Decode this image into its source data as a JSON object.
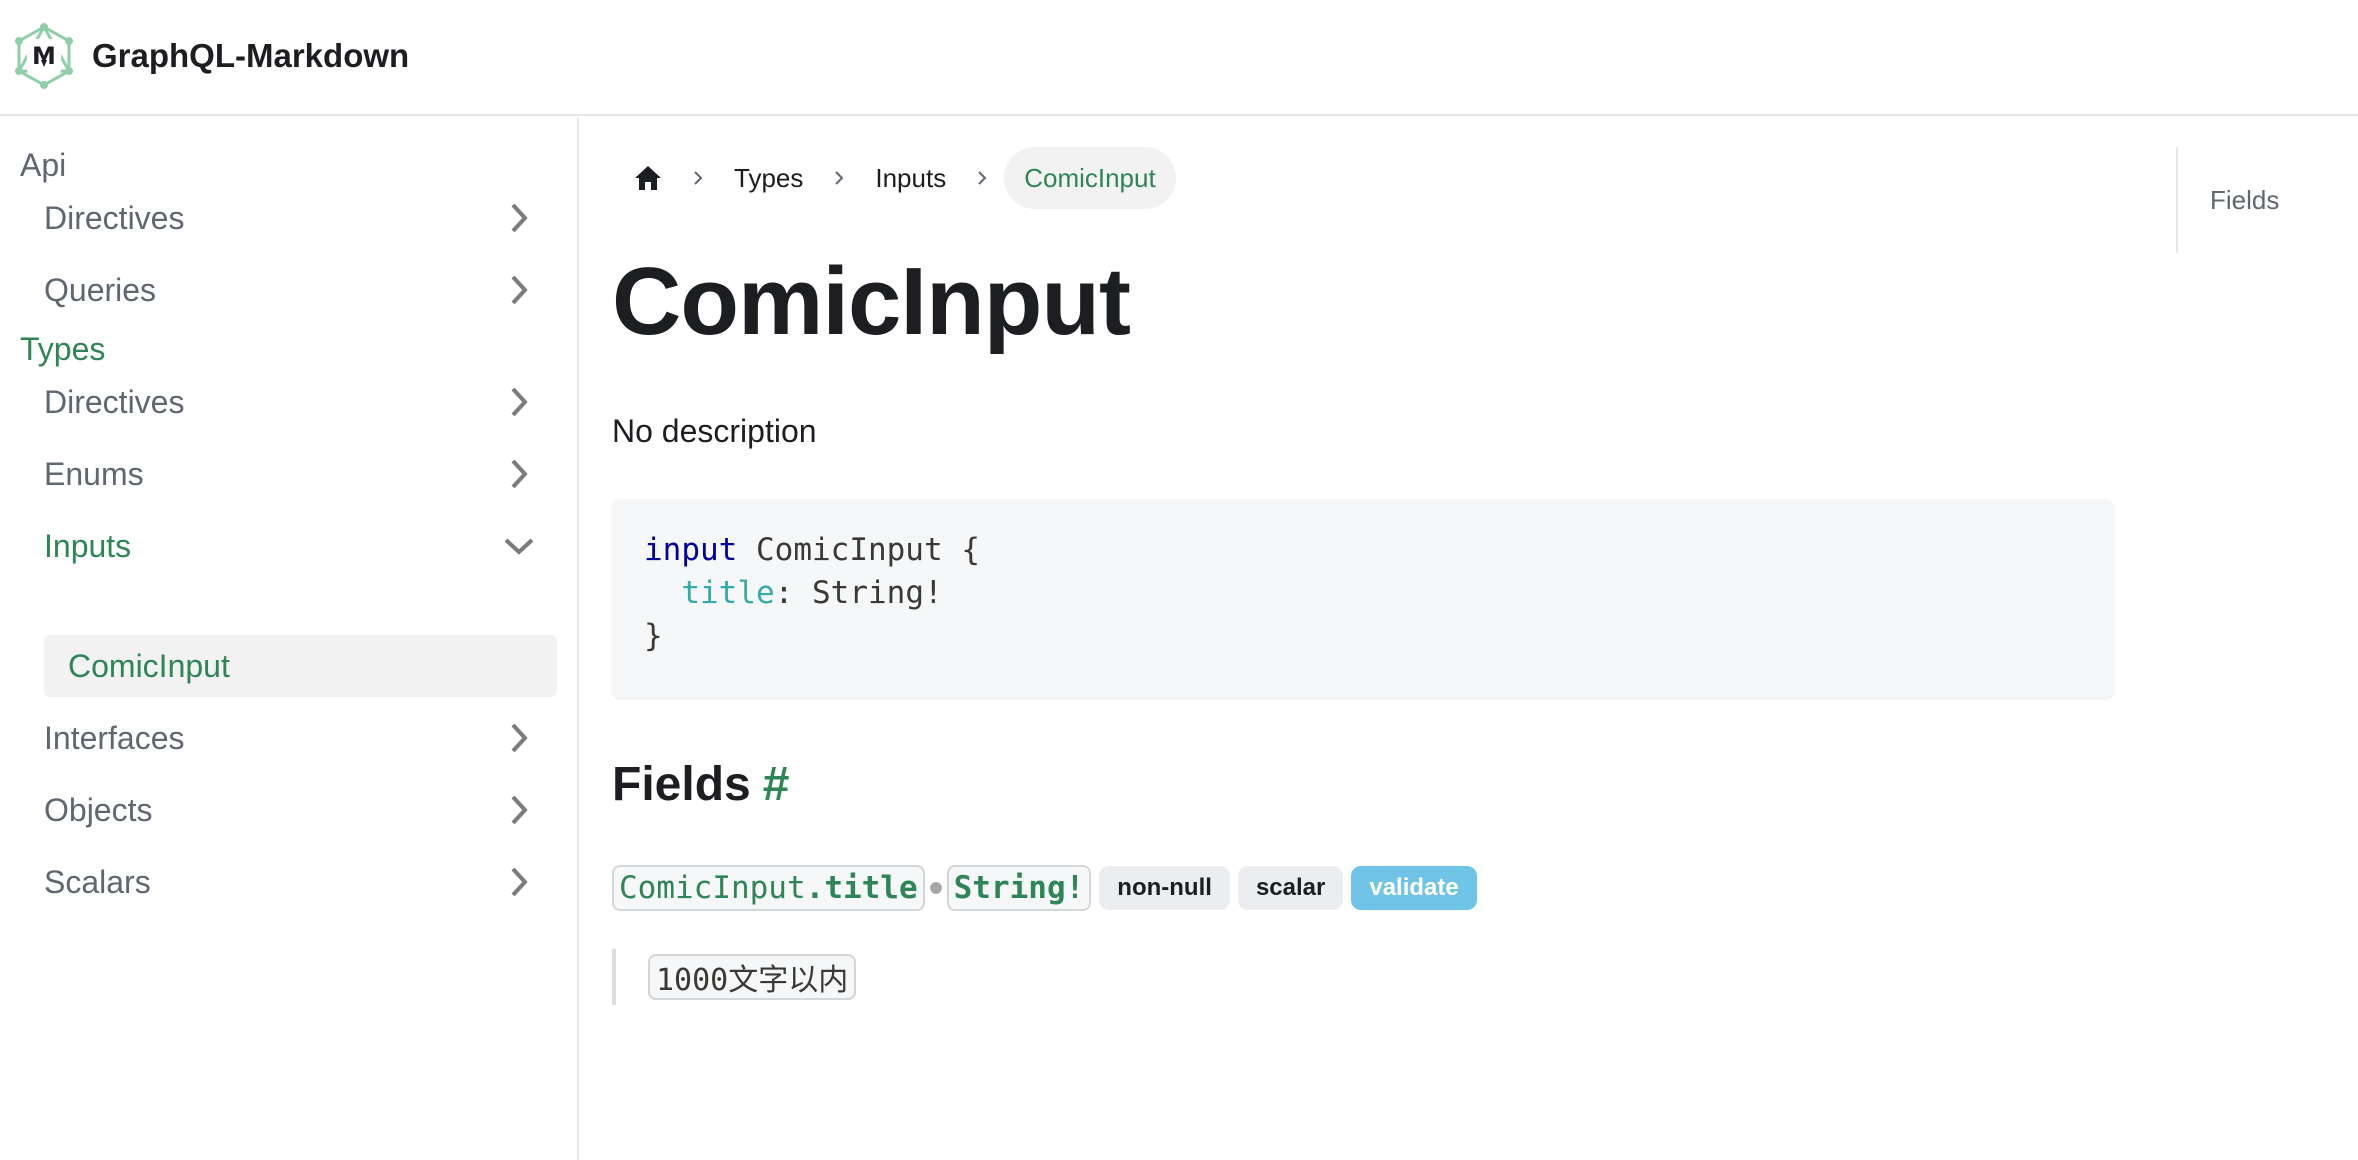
{
  "navbar": {
    "brand": "GraphQL-Markdown",
    "logo_icon": "graphql-markdown-logo-icon"
  },
  "sidebar": {
    "categories": [
      {
        "label": "Api",
        "active": false
      },
      {
        "label": "Types",
        "active": true
      }
    ],
    "api_items": [
      {
        "label": "Directives",
        "icon": "chevron-right-icon"
      },
      {
        "label": "Queries",
        "icon": "chevron-right-icon"
      }
    ],
    "types_items": [
      {
        "label": "Directives",
        "icon": "chevron-right-icon"
      },
      {
        "label": "Enums",
        "icon": "chevron-right-icon"
      },
      {
        "label": "Inputs",
        "icon": "chevron-down-icon",
        "active": true
      },
      {
        "label": "Interfaces",
        "icon": "chevron-right-icon"
      },
      {
        "label": "Objects",
        "icon": "chevron-right-icon"
      },
      {
        "label": "Scalars",
        "icon": "chevron-right-icon"
      }
    ],
    "inputs_children": [
      {
        "label": "ComicInput",
        "active": true
      }
    ]
  },
  "breadcrumbs": {
    "home_icon": "home-icon",
    "items": [
      "Types",
      "Inputs",
      "ComicInput"
    ]
  },
  "page": {
    "title": "ComicInput",
    "description": "No description",
    "code": {
      "keyword": "input",
      "type_name": "ComicInput",
      "open_brace": "{",
      "field": "title",
      "colon": ":",
      "field_type": "String!",
      "close_brace": "}"
    },
    "fields_heading": "Fields",
    "fields_hash": "#",
    "field": {
      "owner": "ComicInput",
      "dot": ".",
      "name": "title",
      "type": "String!",
      "badges": [
        "non-null",
        "scalar",
        "validate"
      ],
      "description": "1000文字以内"
    }
  },
  "toc": {
    "items": [
      "Fields"
    ]
  },
  "colors": {
    "accent": "#2e8555",
    "badge_blue": "#70c4e8"
  }
}
